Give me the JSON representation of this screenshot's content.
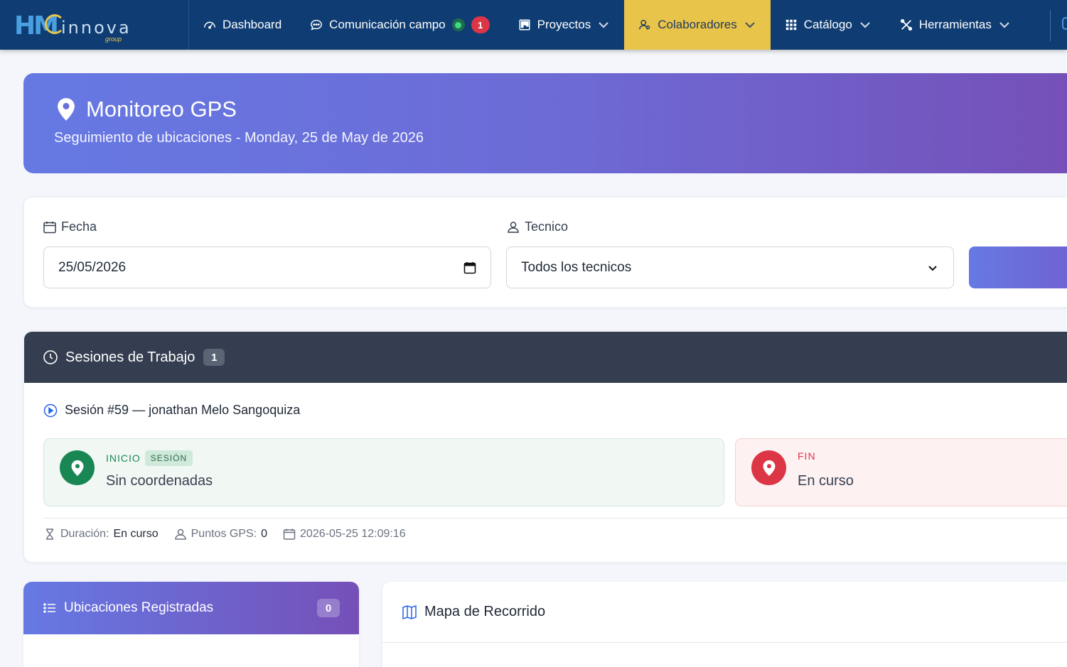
{
  "brand": {
    "logo_main": "HM",
    "logo_text": "innova",
    "logo_sub": "group"
  },
  "nav": {
    "items": [
      {
        "label": "Dashboard",
        "icon": "gauge-icon"
      },
      {
        "label": "Comunicación campo",
        "icon": "chat-icon",
        "badge": "1"
      },
      {
        "label": "Proyectos",
        "icon": "kanban-icon"
      },
      {
        "label": "Colaboradores",
        "icon": "users-icon",
        "active": true
      },
      {
        "label": "Catálogo",
        "icon": "grid-icon"
      },
      {
        "label": "Herramientas",
        "icon": "tools-icon"
      }
    ]
  },
  "hero": {
    "title": "Monitoreo GPS",
    "subtitle": "Seguimiento de ubicaciones - Monday, 25 de May de 2026"
  },
  "filters": {
    "date_label": "Fecha",
    "date_value": "25/05/2026",
    "tech_label": "Tecnico",
    "tech_value": "Todos los tecnicos"
  },
  "sessions": {
    "title": "Sesiones de Trabajo",
    "count": "1",
    "session": {
      "title": "Sesión #59 — jonathan Melo Sangoquiza",
      "start_label": "INICIO",
      "start_tag": "SESIÓN",
      "start_value": "Sin coordenadas",
      "end_label": "FIN",
      "end_value": "En curso",
      "duration_label": "Duración:",
      "duration_value": "En curso",
      "points_label": "Puntos GPS:",
      "points_value": "0",
      "datetime": "2026-05-25 12:09:16"
    }
  },
  "locations": {
    "title": "Ubicaciones Registradas",
    "count": "0"
  },
  "map": {
    "title": "Mapa de Recorrido"
  },
  "colors": {
    "navbar": "#0f3d73",
    "active_nav": "#e9c44a",
    "hero_start": "#6679e3",
    "hero_end": "#7550b8",
    "green": "#198754",
    "red": "#dc3545"
  }
}
